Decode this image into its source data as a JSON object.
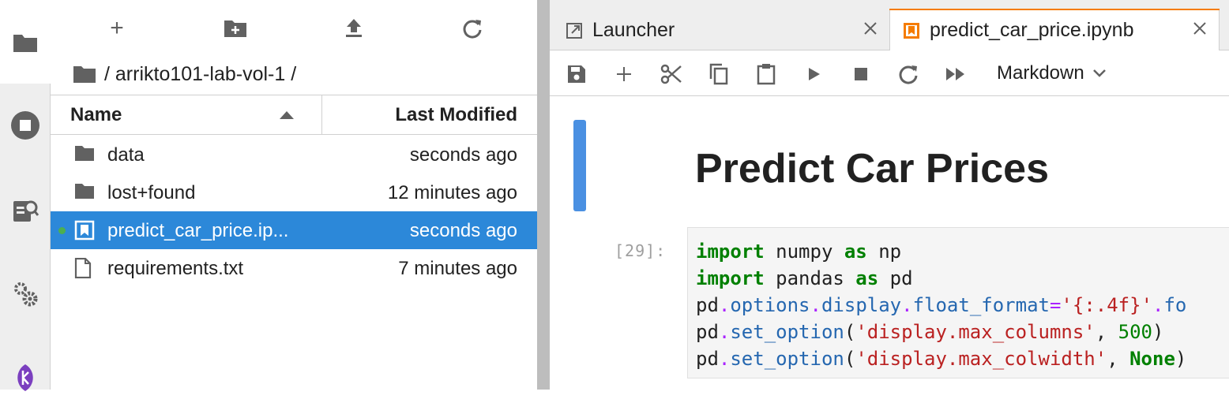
{
  "file_browser": {
    "toolbar": {
      "new_launcher": "+",
      "new_folder_icon": "new-folder-icon",
      "upload_icon": "upload-icon",
      "refresh_icon": "refresh-icon"
    },
    "breadcrumb": "/ arrikto101-lab-vol-1 /",
    "columns": {
      "name": "Name",
      "modified": "Last Modified"
    },
    "files": [
      {
        "name": "data",
        "modified": "seconds ago",
        "icon": "folder-icon",
        "selected": false,
        "running": false
      },
      {
        "name": "lost+found",
        "modified": "12 minutes ago",
        "icon": "folder-icon",
        "selected": false,
        "running": false
      },
      {
        "name": "predict_car_price.ip...",
        "modified": "seconds ago",
        "icon": "notebook-icon",
        "selected": true,
        "running": true
      },
      {
        "name": "requirements.txt",
        "modified": "7 minutes ago",
        "icon": "file-icon",
        "selected": false,
        "running": false
      }
    ]
  },
  "tabs": [
    {
      "label": "Launcher",
      "icon": "launcher-icon",
      "active": false
    },
    {
      "label": "predict_car_price.ipynb",
      "icon": "notebook-icon",
      "active": true
    }
  ],
  "notebook": {
    "cell_type": "Markdown",
    "heading": "Predict Car Prices",
    "prompt": "[29]:",
    "code_lines": [
      "import numpy as np",
      "import pandas as pd",
      "pd.options.display.float_format='{:.4f}'.fo",
      "pd.set_option('display.max_columns', 500)",
      "pd.set_option('display.max_colwidth', None)"
    ]
  },
  "colors": {
    "selection": "#2c88d9",
    "active_cell": "#4a90e2",
    "tab_accent": "#f57c00",
    "running_dot": "#4caf50",
    "kubeflow": "#7b3fbf"
  }
}
